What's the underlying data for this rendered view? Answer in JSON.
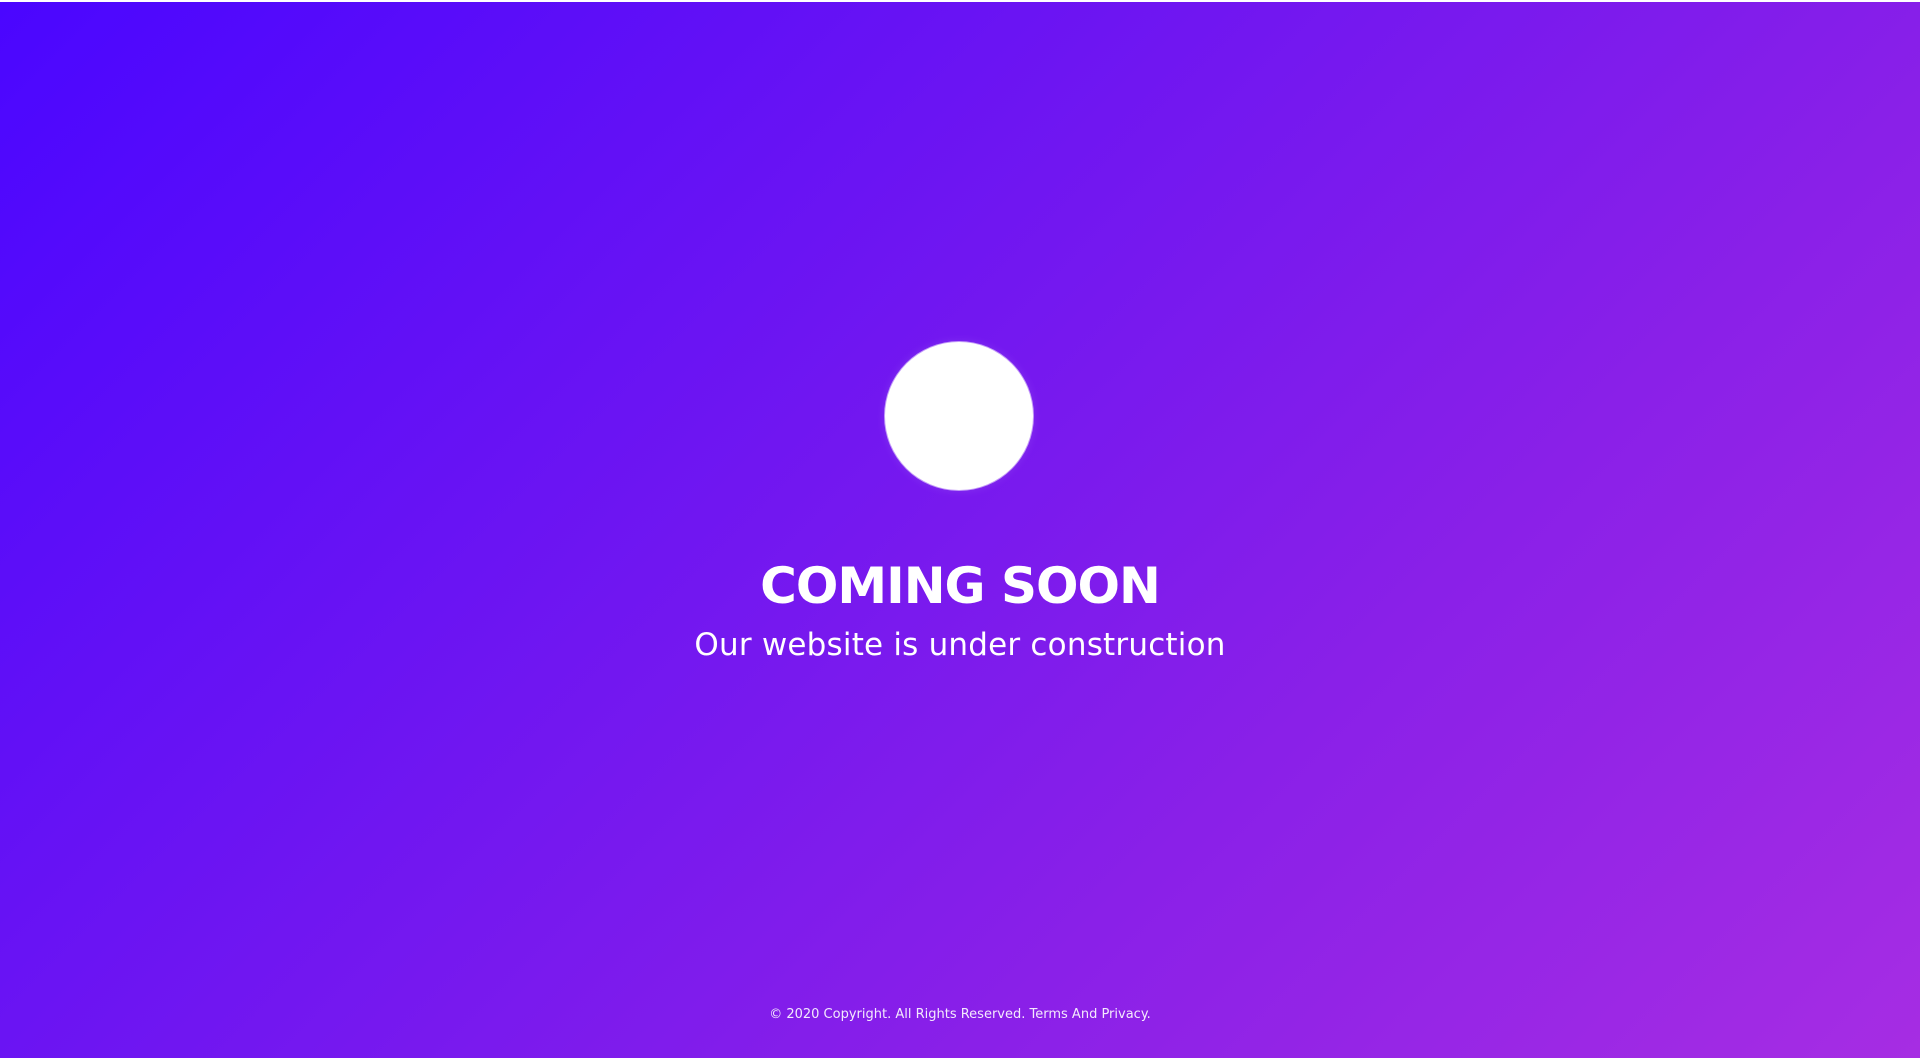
{
  "page": {
    "title": "COMING SOON",
    "subtitle": "Our website is under construction"
  },
  "footer": {
    "copyright": "© 2020 Copyright. All Rights Reserved.",
    "terms_link": "Terms And Privacy."
  },
  "theme": {
    "gradient_start": "#4a06ff",
    "gradient_end": "#a62de3",
    "text_color": "#ffffff"
  },
  "icons": {
    "logo": "logo-circle"
  }
}
